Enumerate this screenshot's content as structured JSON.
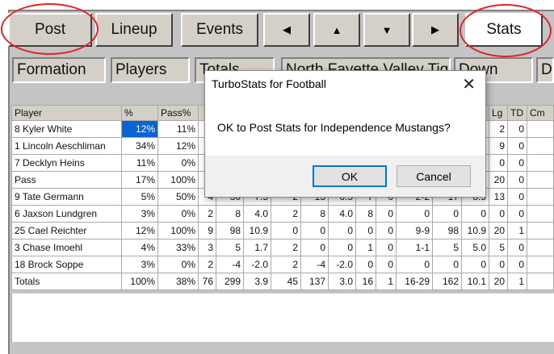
{
  "toolbar": {
    "post": "Post",
    "lineup": "Lineup",
    "events": "Events",
    "stats": "Stats",
    "arrows": [
      "◀",
      "▲",
      "▼",
      "▶"
    ]
  },
  "fields": {
    "formation": "Formation",
    "players": "Players",
    "totals": "Totals",
    "team": "North Fayette Valley Tige",
    "down": "Down",
    "d": "D"
  },
  "table": {
    "headers": [
      "Player",
      "%",
      "Pass%",
      "",
      "",
      "",
      "",
      "",
      "",
      "",
      "",
      "",
      "",
      "g",
      "Lg",
      "TD",
      "Cm"
    ],
    "rows": [
      [
        "8 Kyler White",
        "12%",
        "11%",
        "",
        "",
        "",
        "",
        "",
        "",
        "",
        "",
        "",
        "",
        "0",
        "2",
        "0",
        ""
      ],
      [
        "1 Lincoln Aeschliman",
        "34%",
        "12%",
        "",
        "",
        "",
        "",
        "",
        "",
        "",
        "",
        "",
        "",
        "3",
        "9",
        "0",
        ""
      ],
      [
        "7 Decklyn Heins",
        "11%",
        "0%",
        "",
        "",
        "",
        "",
        "",
        "",
        "",
        "",
        "",
        "",
        "0",
        "0",
        "0",
        ""
      ],
      [
        "Pass",
        "17%",
        "100%",
        "",
        "",
        "",
        "",
        "",
        "",
        "",
        "",
        "",
        "",
        "0",
        "20",
        "0",
        ""
      ],
      [
        "9 Tate Germann",
        "5%",
        "50%",
        "4",
        "30",
        "7.5",
        "2",
        "13",
        "6.5",
        "7",
        "0",
        "2-2",
        "17",
        "8.5",
        "13",
        "0",
        ""
      ],
      [
        "6 Jaxson Lundgren",
        "3%",
        "0%",
        "2",
        "8",
        "4.0",
        "2",
        "8",
        "4.0",
        "8",
        "0",
        "0",
        "0",
        "0",
        "0",
        "0",
        ""
      ],
      [
        "25 Cael Reichter",
        "12%",
        "100%",
        "9",
        "98",
        "10.9",
        "0",
        "0",
        "0",
        "0",
        "0",
        "9-9",
        "98",
        "10.9",
        "20",
        "1",
        ""
      ],
      [
        "3 Chase Imoehl",
        "4%",
        "33%",
        "3",
        "5",
        "1.7",
        "2",
        "0",
        "0",
        "1",
        "0",
        "1-1",
        "5",
        "5.0",
        "5",
        "0",
        ""
      ],
      [
        "18 Brock Soppe",
        "3%",
        "0%",
        "2",
        "-4",
        "-2.0",
        "2",
        "-4",
        "-2.0",
        "0",
        "0",
        "0",
        "0",
        "0",
        "0",
        "0",
        ""
      ],
      [
        "Totals",
        "100%",
        "38%",
        "76",
        "299",
        "3.9",
        "45",
        "137",
        "3.0",
        "16",
        "1",
        "16-29",
        "162",
        "10.1",
        "20",
        "1",
        ""
      ]
    ]
  },
  "dialog": {
    "title": "TurboStats for Football",
    "close": "✕",
    "message": "OK to Post Stats for Independence Mustangs?",
    "ok": "OK",
    "cancel": "Cancel"
  },
  "colors": {
    "annotation": "#e0242b",
    "selection": "#0a64d2",
    "dialog_focus": "#0078d7"
  }
}
